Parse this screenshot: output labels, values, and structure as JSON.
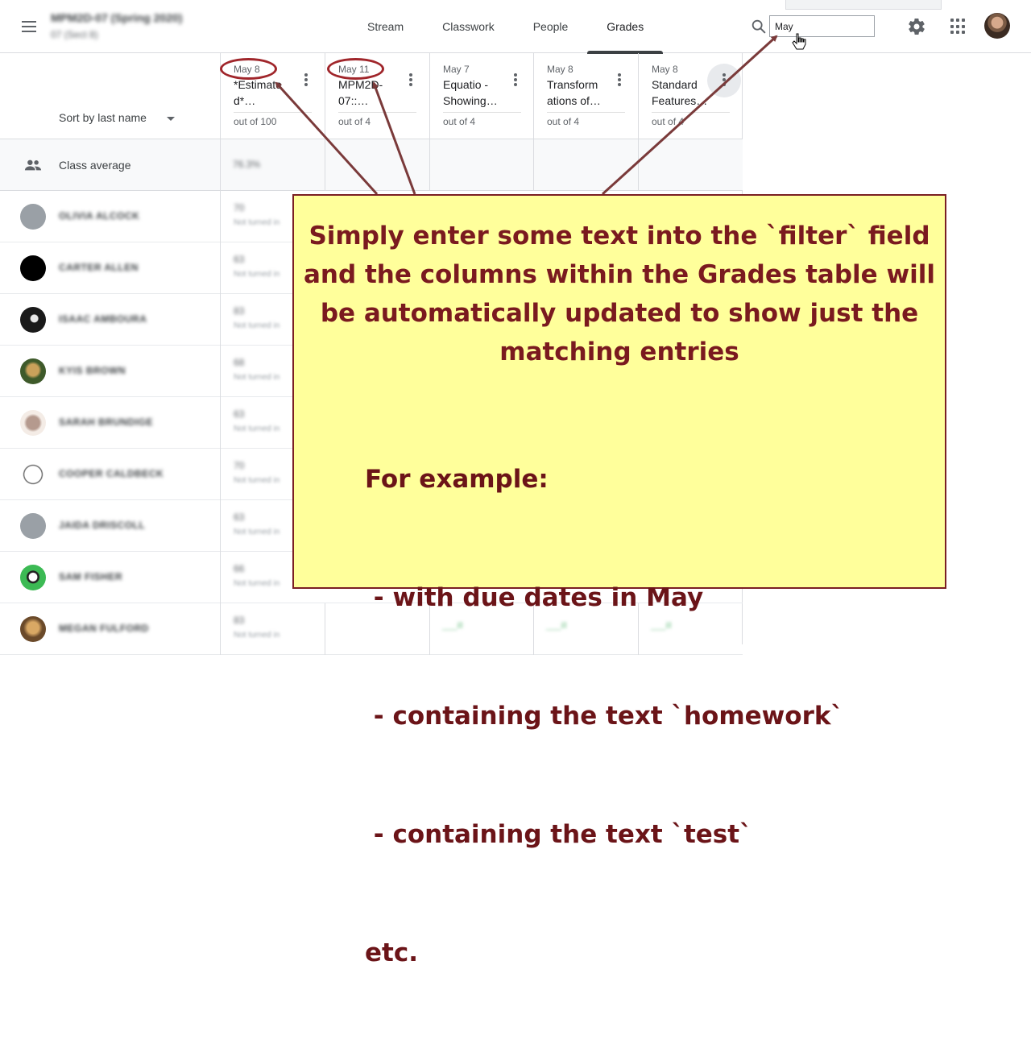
{
  "header": {
    "course_title": "MPM2D-07 (Spring 2020)",
    "course_subtitle": "07 (Sect 8)",
    "tabs": [
      {
        "label": "Stream"
      },
      {
        "label": "Classwork"
      },
      {
        "label": "People"
      },
      {
        "label": "Grades",
        "active": true
      }
    ],
    "filter_value": "May"
  },
  "grades": {
    "sort_label": "Sort by last name",
    "class_average_label": "Class average",
    "class_average_value": "76.3%",
    "columns": [
      {
        "date": "May 8",
        "title": "*Estimated*...",
        "title_lines": [
          "*Estimate",
          "d*…"
        ],
        "out_of": "out of 100"
      },
      {
        "date": "May 11",
        "title": "MPM2D-07::...",
        "title_lines": [
          "MPM2D-",
          "07::…"
        ],
        "out_of": "out of 4"
      },
      {
        "date": "May 7",
        "title": "Equatio - Showing...",
        "title_lines": [
          "Equatio -",
          "Showing…"
        ],
        "out_of": "out of 4"
      },
      {
        "date": "May 8",
        "title": "Transformations of...",
        "title_lines": [
          "Transform",
          "ations of…"
        ],
        "out_of": "out of 4"
      },
      {
        "date": "May 8",
        "title": "Standard Features...",
        "title_lines": [
          "Standard",
          "Features…"
        ],
        "out_of": "out of 4"
      }
    ],
    "students": [
      {
        "name": "Olivia Alcock",
        "avatar": "grey",
        "grade": "70",
        "note": "Not turned in"
      },
      {
        "name": "Carter Allen",
        "avatar": "black",
        "grade": "63",
        "note": "Not turned in"
      },
      {
        "name": "Isaac Amboura",
        "avatar": "dark-art",
        "grade": "83",
        "note": "Not turned in"
      },
      {
        "name": "Kyis Brown",
        "avatar": "photo-green",
        "grade": "68",
        "note": "Not turned in"
      },
      {
        "name": "Sarah Brundige",
        "avatar": "cat",
        "grade": "63",
        "note": "Not turned in"
      },
      {
        "name": "Cooper Caldbeck",
        "avatar": "meme",
        "grade": "70",
        "note": "Not turned in"
      },
      {
        "name": "Jaida Driscoll",
        "avatar": "grey",
        "grade": "63",
        "note": "Not turned in"
      },
      {
        "name": "Sam Fisher",
        "avatar": "green-bird",
        "grade": "66",
        "note": "Not turned in"
      },
      {
        "name": "Megan Fulford",
        "avatar": "photo-brown",
        "grade": "83",
        "note": "Not turned in"
      }
    ]
  },
  "annotation": {
    "main_text": "Simply enter some text into the `filter` field and the columns within the Grades table will be automatically updated to show just the matching entries",
    "main_lines": [
      "Simply enter some text into the `filter` field",
      "and the columns within the Grades table will",
      "be automatically updated to show just the",
      "matching entries"
    ],
    "example_heading": "For example:",
    "examples": [
      " - with due dates in May",
      " - containing the text `homework`",
      " - containing the text `test`"
    ],
    "etc": "etc.",
    "color": "#7a1a1f",
    "box_color": "#ffff9b"
  }
}
